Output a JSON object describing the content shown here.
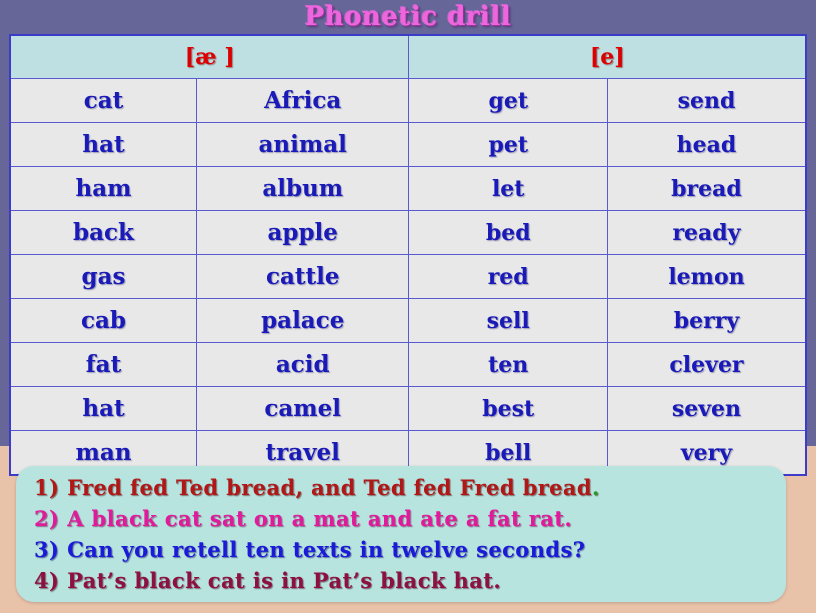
{
  "title": "Phonetic drill",
  "table": {
    "headers": [
      {
        "label": "[æ ]",
        "span": 2
      },
      {
        "label": "[e]",
        "span": 2
      }
    ],
    "rows": [
      [
        "cat",
        "Africa",
        "get",
        "send"
      ],
      [
        "hat",
        "animal",
        "pet",
        "head"
      ],
      [
        "ham",
        "album",
        "let",
        "bread"
      ],
      [
        "back",
        "apple",
        "bed",
        "ready"
      ],
      [
        "gas",
        "cattle",
        "red",
        "lemon"
      ],
      [
        "cab",
        "palace",
        "sell",
        "berry"
      ],
      [
        "fat",
        "acid",
        "ten",
        "clever"
      ],
      [
        "hat",
        "camel",
        "best",
        "seven"
      ],
      [
        "man",
        "travel",
        "bell",
        "very"
      ]
    ]
  },
  "tongue_twisters": [
    {
      "number": "1)",
      "text": "Fred fed Ted bread, and Ted fed Fred bread",
      "end_mark": ".",
      "color": "#b01818",
      "end_mark_color": "#1f9b28"
    },
    {
      "number": "2)",
      "text": "A black cat sat on a mat and ate a fat rat.",
      "end_mark": "",
      "color": "#e01a9a",
      "end_mark_color": ""
    },
    {
      "number": "3)",
      "text": "Can you retell ten texts in twelve seconds?",
      "end_mark": "",
      "color": "#1a1ad8",
      "end_mark_color": ""
    },
    {
      "number": "4)",
      "text": "Pat’s black cat is in Pat’s black hat.",
      "end_mark": "",
      "color": "#8c1040",
      "end_mark_color": ""
    }
  ],
  "colors": {
    "slide_background": "#666699",
    "lower_background": "#e9c2aa",
    "title": "#ee66dd",
    "header_cell_background": "#bfe0e2",
    "header_cell_text": "#dd0000",
    "cell_background": "#e8e8e8",
    "cell_text": "#1a1ab8",
    "table_border": "#3c3cc8",
    "twister_panel_background": "#b8e4e0"
  }
}
